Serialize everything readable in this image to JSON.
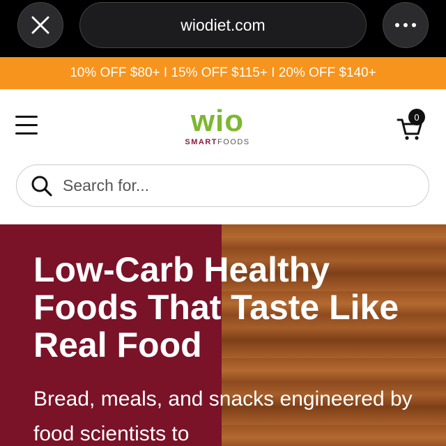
{
  "browser": {
    "url": "wiodiet.com",
    "close_icon": "close-icon",
    "more_icon": "more-icon"
  },
  "promo": {
    "text": "10% OFF $80+ I 15% OFF $115+ I 20% OFF $140+",
    "color": "#f7941d"
  },
  "header": {
    "logo_mark": "wio",
    "logo_sub_bold": "SMART",
    "logo_sub_rest": "FOODS",
    "cart_count": "0",
    "search_placeholder": "Search for..."
  },
  "hero": {
    "title": "Low-Carb Healthy Foods That Taste Like Real Food",
    "subtitle": "Bread, meals, and snacks engineered by food scientists to",
    "left_color": "#7a1228"
  }
}
